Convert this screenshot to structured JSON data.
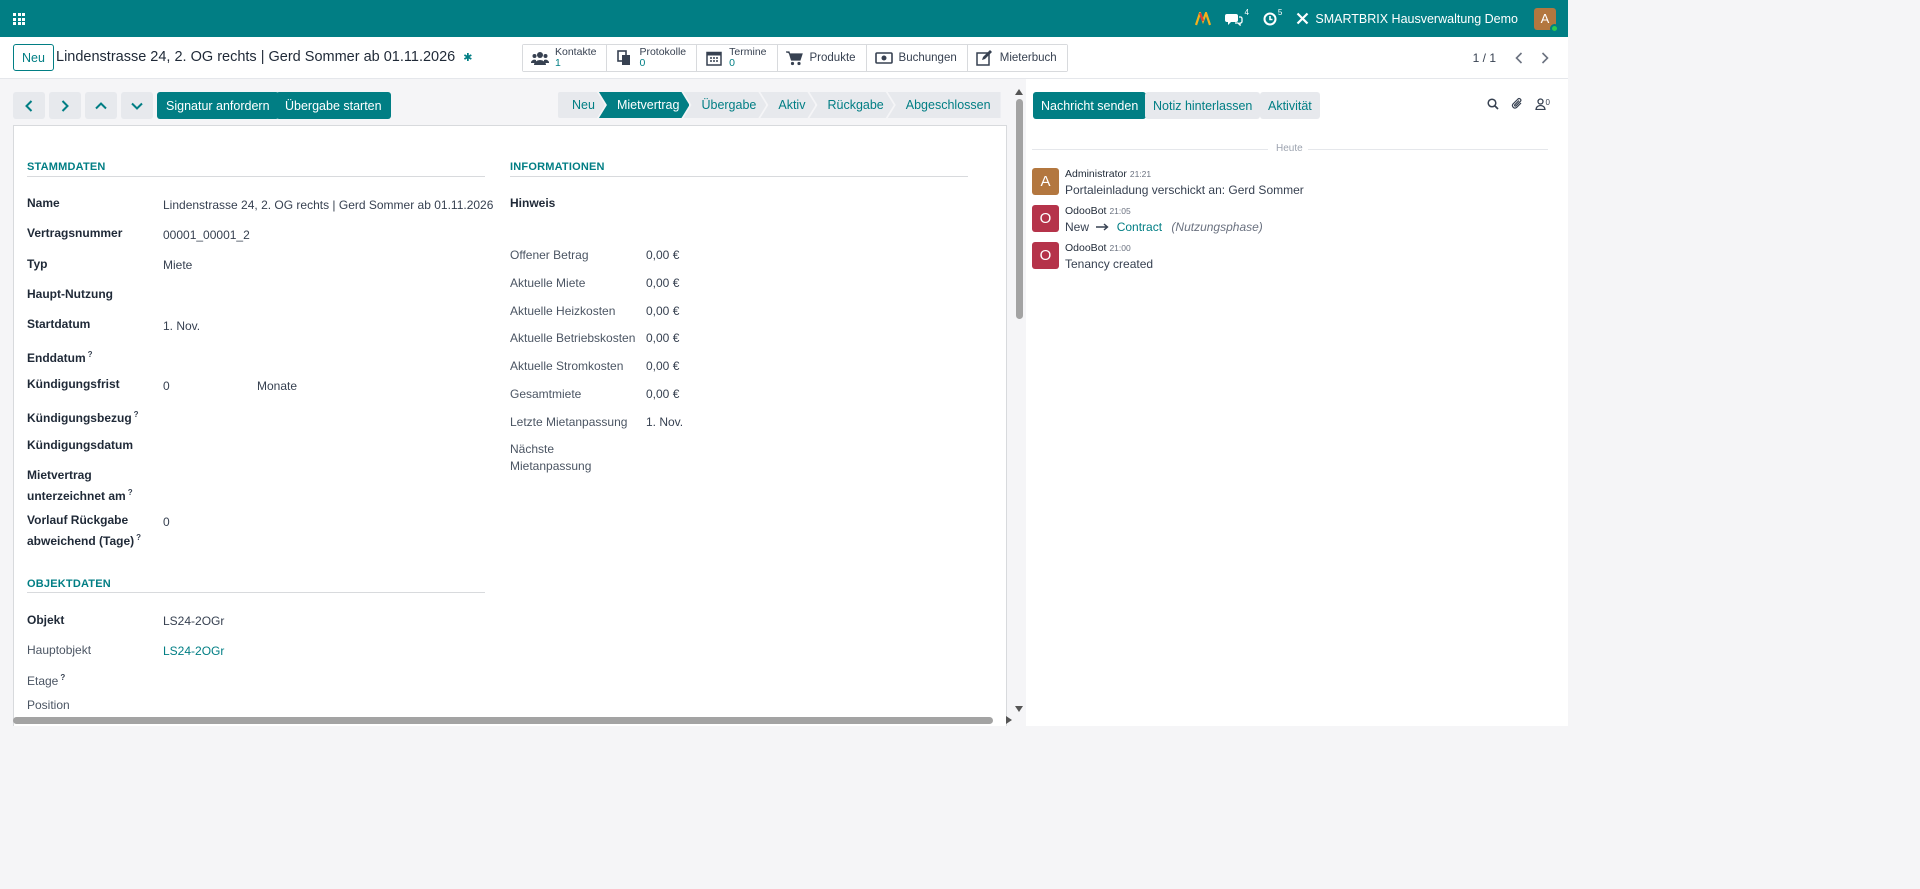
{
  "topbar": {
    "company": "SMARTBRIX Hausverwaltung Demo",
    "chat_count": "4",
    "activity_count": "5",
    "user_initial": "A",
    "colors": {
      "brand": "#017e84",
      "avatar": "#b3773f",
      "online": "#2ac94f"
    }
  },
  "control": {
    "new_label": "Neu",
    "record_title": "Lindenstrasse 24, 2. OG rechts | Gerd Sommer ab 01.11.2026",
    "smart_buttons": [
      {
        "label": "Kontakte",
        "count": "1",
        "icon": "users-icon"
      },
      {
        "label": "Protokolle",
        "count": "0",
        "icon": "document-copy-icon"
      },
      {
        "label": "Termine",
        "count": "0",
        "icon": "calendar-icon"
      },
      {
        "label": "Produkte",
        "icon": "cart-icon"
      },
      {
        "label": "Buchungen",
        "icon": "money-icon"
      },
      {
        "label": "Mieterbuch",
        "icon": "edit-icon"
      }
    ],
    "pager": "1 / 1"
  },
  "form": {
    "actions": {
      "signature": "Signatur anfordern",
      "handover": "Übergabe starten"
    },
    "stages": [
      "Neu",
      "Mietvertrag",
      "Übergabe",
      "Aktiv",
      "Rückgabe",
      "Abgeschlossen"
    ],
    "active_stage": "Mietvertrag",
    "stammdaten": {
      "title": "STAMMDATEN",
      "name_label": "Name",
      "name_value": "Lindenstrasse 24, 2. OG rechts | Gerd Sommer ab 01.11.2026",
      "contract_label": "Vertragsnummer",
      "contract_value": "00001_00001_2",
      "type_label": "Typ",
      "type_value": "Miete",
      "usage_label": "Haupt-Nutzung",
      "start_label": "Startdatum",
      "start_value": "1. Nov.",
      "end_label": "Enddatum",
      "notice_label": "Kündigungsfrist",
      "notice_value": "0",
      "notice_unit": "Monate",
      "notice_ref_label": "Kündigungsbezug",
      "notice_date_label": "Kündigungsdatum",
      "signed_label_1": "Mietvertrag",
      "signed_label_2": "unterzeichnet am",
      "lead_label_1": "Vorlauf Rückgabe",
      "lead_label_2": "abweichend (Tage)",
      "lead_value": "0",
      "help_mark": "?"
    },
    "informationen": {
      "title": "INFORMATIONEN",
      "hint_label": "Hinweis",
      "open_label": "Offener Betrag",
      "open_value": "0,00 €",
      "rent_label": "Aktuelle Miete",
      "rent_value": "0,00 €",
      "heating_label": "Aktuelle Heizkosten",
      "heating_value": "0,00 €",
      "operating_label": "Aktuelle Betriebskosten",
      "operating_value": "0,00 €",
      "power_label": "Aktuelle Stromkosten",
      "power_value": "0,00 €",
      "total_label": "Gesamtmiete",
      "total_value": "0,00 €",
      "last_adj_label": "Letzte Mietanpassung",
      "last_adj_value": "1. Nov.",
      "next_adj_label_1": "Nächste",
      "next_adj_label_2": "Mietanpassung"
    },
    "objektdaten": {
      "title": "OBJEKTDATEN",
      "object_label": "Objekt",
      "object_value": "LS24-2OGr",
      "main_object_label": "Hauptobjekt",
      "main_object_value": "LS24-2OGr",
      "floor_label": "Etage",
      "position_label": "Position"
    }
  },
  "chatter": {
    "send_message": "Nachricht senden",
    "log_note": "Notiz hinterlassen",
    "activity": "Aktivität",
    "followers_count": "0",
    "today": "Heute",
    "messages": [
      {
        "initial": "A",
        "color": "#b3773f",
        "author": "Administrator",
        "time": "21:21",
        "text": "Portaleinladung verschickt an: Gerd Sommer"
      },
      {
        "initial": "O",
        "color": "#b5334a",
        "author": "OdooBot",
        "time": "21:05",
        "from": "New",
        "to": "Contract",
        "note": "(Nutzungsphase)"
      },
      {
        "initial": "O",
        "color": "#b5334a",
        "author": "OdooBot",
        "time": "21:00",
        "text": "Tenancy created"
      }
    ]
  }
}
